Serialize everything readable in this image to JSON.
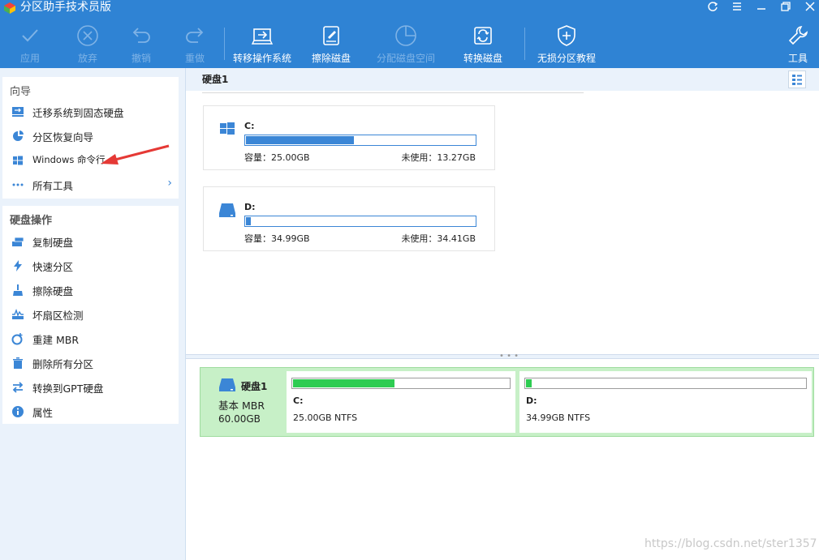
{
  "window": {
    "title": "分区助手技术员版",
    "controls": [
      "refresh-icon",
      "menu-icon",
      "minimize-icon",
      "restore-icon",
      "close-icon"
    ]
  },
  "toolbar": {
    "apply": "应用",
    "discard": "放弃",
    "undo": "撤销",
    "redo": "重做",
    "migrate_os": "转移操作系统",
    "wipe_disk": "擦除磁盘",
    "allocate_space": "分配磁盘空间",
    "convert_disk": "转换磁盘",
    "lossless_tutorial": "无损分区教程",
    "tools": "工具"
  },
  "wizard": {
    "title": "向导",
    "items": [
      {
        "label": "迁移系统到固态硬盘",
        "icon": "migrate-ssd-icon"
      },
      {
        "label": "分区恢复向导",
        "icon": "partition-recovery-icon"
      },
      {
        "label": "Windows 命令行",
        "icon": "windows-icon"
      },
      {
        "label": "所有工具",
        "icon": "more-dots-icon",
        "has_submenu": true
      }
    ]
  },
  "disk_ops": {
    "title": "硬盘操作",
    "items": [
      {
        "label": "复制硬盘",
        "icon": "copy-disk-icon"
      },
      {
        "label": "快速分区",
        "icon": "lightning-icon"
      },
      {
        "label": "擦除硬盘",
        "icon": "wipe-broom-icon"
      },
      {
        "label": "坏扇区检测",
        "icon": "bad-sector-icon"
      },
      {
        "label": "重建 MBR",
        "icon": "rebuild-mbr-icon"
      },
      {
        "label": "删除所有分区",
        "icon": "trash-icon"
      },
      {
        "label": "转换到GPT硬盘",
        "icon": "convert-gpt-icon"
      },
      {
        "label": "属性",
        "icon": "info-icon"
      }
    ]
  },
  "disk": {
    "name": "硬盘1",
    "type": "基本 MBR",
    "size": "60.00GB",
    "partitions": [
      {
        "letter": "C:",
        "capacity_label": "容量：25.00GB",
        "free_label": "未使用：13.27GB",
        "map_info": "25.00GB NTFS",
        "used_fraction": 0.47,
        "icon": "windows-drive-icon"
      },
      {
        "letter": "D:",
        "capacity_label": "容量：34.99GB",
        "free_label": "未使用：34.41GB",
        "map_info": "34.99GB NTFS",
        "used_fraction": 0.02,
        "icon": "drive-icon"
      }
    ]
  },
  "watermark": "https://blog.csdn.net/ster1357",
  "colors": {
    "accent": "#2f83d4",
    "used_bar": "#3b86d6",
    "map_used": "#2ecc52",
    "map_bg": "#c7f0c7",
    "annotation_arrow": "#e53935"
  }
}
